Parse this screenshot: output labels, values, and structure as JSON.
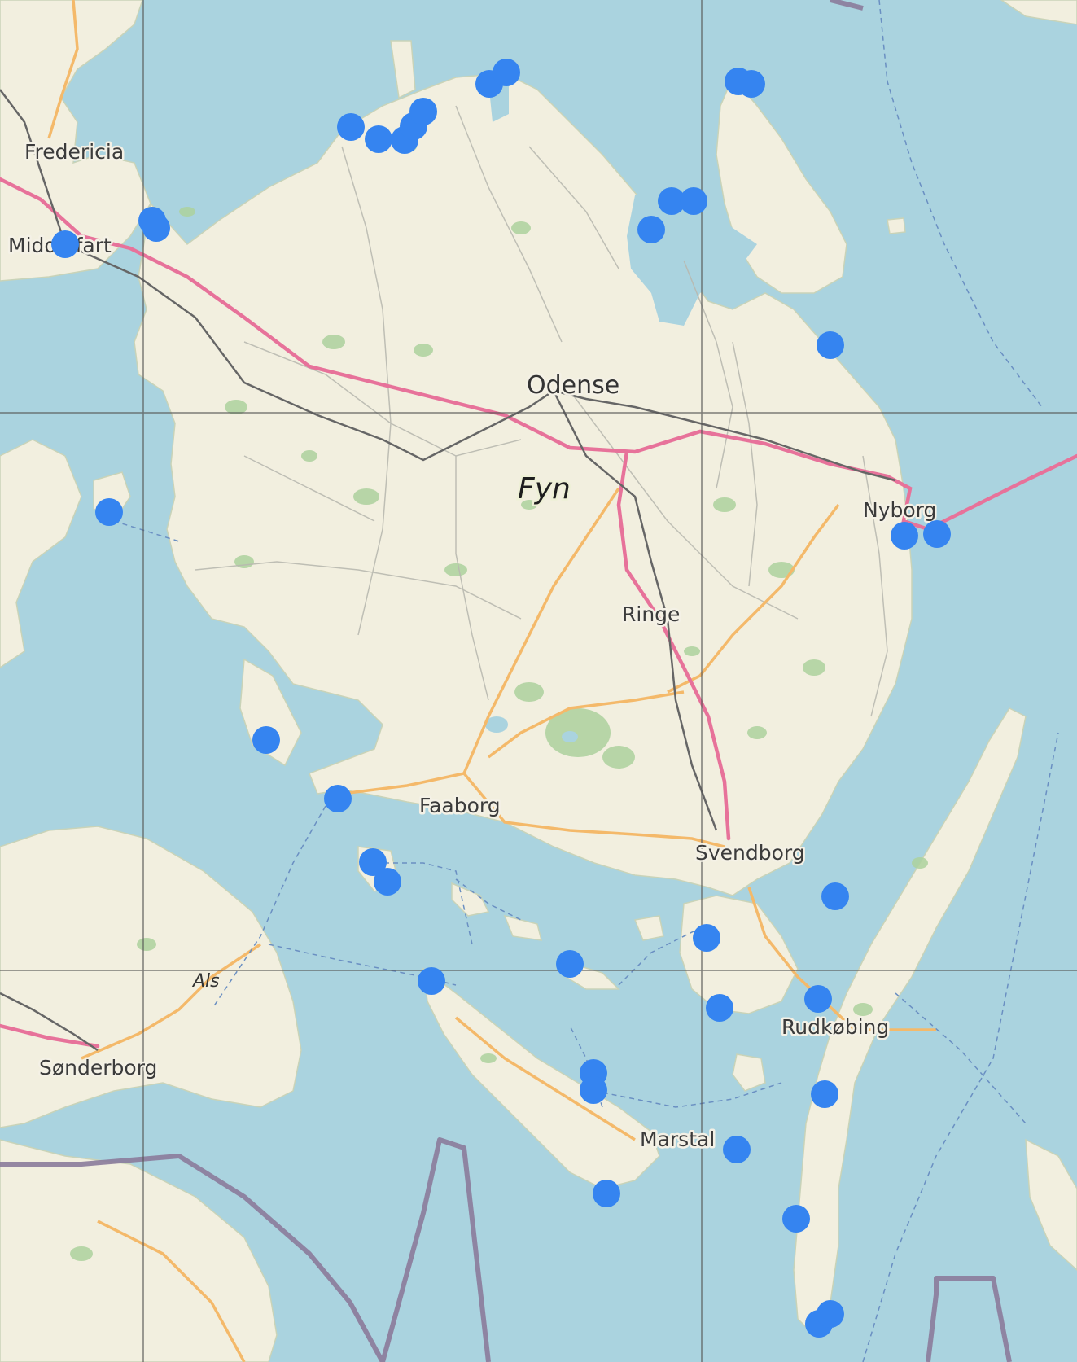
{
  "map": {
    "island_label": "Fyn",
    "cities": [
      {
        "id": "fredericia",
        "name": "Fredericia"
      },
      {
        "id": "middelfart",
        "name": "Middelfart"
      },
      {
        "id": "odense",
        "name": "Odense"
      },
      {
        "id": "nyborg",
        "name": "Nyborg"
      },
      {
        "id": "ringe",
        "name": "Ringe"
      },
      {
        "id": "faaborg",
        "name": "Faaborg"
      },
      {
        "id": "svendborg",
        "name": "Svendborg"
      },
      {
        "id": "als",
        "name": "Als"
      },
      {
        "id": "sonderborg",
        "name": "Sønderborg"
      },
      {
        "id": "rudkobing",
        "name": "Rudkøbing"
      },
      {
        "id": "marstal",
        "name": "Marstal"
      }
    ],
    "marker_count": 42,
    "colors": {
      "sea": "#aad3df",
      "land": "#f2efdf",
      "forest": "#add19e",
      "motorway": "#e7729a",
      "primary_road": "#f4b96a",
      "railway": "#666666",
      "border": "#8b7b9b",
      "marker": "#3584f0",
      "grid": "#555555"
    }
  }
}
